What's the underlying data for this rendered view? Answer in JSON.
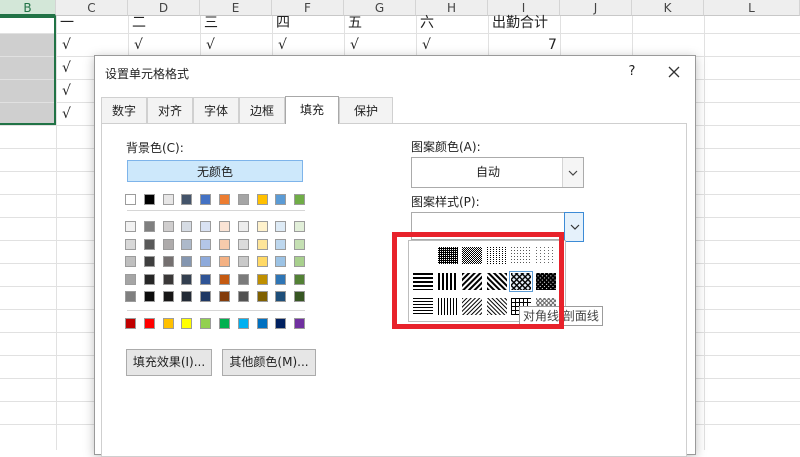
{
  "sheet": {
    "column_headers": [
      "B",
      "C",
      "D",
      "E",
      "F",
      "G",
      "H",
      "I",
      "J",
      "K",
      "L"
    ],
    "header_row": [
      "一",
      "二",
      "三",
      "四",
      "五",
      "六",
      "出勤合计"
    ],
    "check_mark": "√",
    "row1_total": "7"
  },
  "dialog": {
    "title": "设置单元格格式",
    "help": "?",
    "tabs": [
      "数字",
      "对齐",
      "字体",
      "边框",
      "填充",
      "保护"
    ],
    "active_tab": "填充",
    "background_color_label": "背景色(C):",
    "no_color_label": "无颜色",
    "fill_effects_label": "填充效果(I)...",
    "more_colors_label": "其他颜色(M)...",
    "pattern_color_label": "图案颜色(A):",
    "pattern_color_value": "自动",
    "pattern_style_label": "图案样式(P):",
    "tooltip": "对角线 剖面线"
  },
  "colors": {
    "theme_top": [
      "#ffffff",
      "#000000",
      "#e7e6e6",
      "#44546a",
      "#4472c4",
      "#ed7d31",
      "#a5a5a5",
      "#ffc000",
      "#5b9bd5",
      "#70ad47"
    ],
    "theme_tints": [
      [
        "#f2f2f2",
        "#7f7f7f",
        "#d0cece",
        "#d6dce4",
        "#d9e2f3",
        "#fbe4d5",
        "#ededed",
        "#fff2cc",
        "#deebf6",
        "#e2efd9"
      ],
      [
        "#d8d8d8",
        "#595959",
        "#aeabab",
        "#adb9ca",
        "#b4c6e7",
        "#f7cbac",
        "#dbdbdb",
        "#fee599",
        "#bdd7ee",
        "#c5e0b3"
      ],
      [
        "#bfbfbf",
        "#3f3f3f",
        "#757070",
        "#8496b0",
        "#8eaadb",
        "#f4b183",
        "#c9c9c9",
        "#ffd965",
        "#9cc3e5",
        "#a8d08d"
      ],
      [
        "#a5a5a5",
        "#262626",
        "#3a3838",
        "#333f4f",
        "#2f5496",
        "#c55a11",
        "#7b7b7b",
        "#bf8f00",
        "#2e75b5",
        "#538135"
      ],
      [
        "#7f7f7f",
        "#0c0c0c",
        "#171616",
        "#222a35",
        "#1f3864",
        "#833c0b",
        "#525252",
        "#7f6000",
        "#1e4e79",
        "#375623"
      ]
    ],
    "standard": [
      "#c00000",
      "#ff0000",
      "#ffc000",
      "#ffff00",
      "#92d050",
      "#00b050",
      "#00b0f0",
      "#0070c0",
      "#002060",
      "#7030a0"
    ],
    "highlight": "#e8222b",
    "selection_green": "#217346"
  },
  "patterns": {
    "row1": [
      "dense-dots",
      "medium-dots",
      "light-dots",
      "fine-dots",
      "sparse-dots"
    ],
    "row2": [
      "horizontal-stripe",
      "vertical-stripe",
      "reverse-diagonal-stripe",
      "diagonal-stripe",
      "diagonal-crosshatch",
      "thick-diagonal-crosshatch"
    ],
    "row3": [
      "thin-horizontal-stripe",
      "thin-vertical-stripe",
      "thin-reverse-diagonal-stripe",
      "thin-diagonal-stripe",
      "thin-horizontal-crosshatch",
      "thin-diagonal-crosshatch"
    ],
    "hovered": "diagonal-crosshatch"
  }
}
